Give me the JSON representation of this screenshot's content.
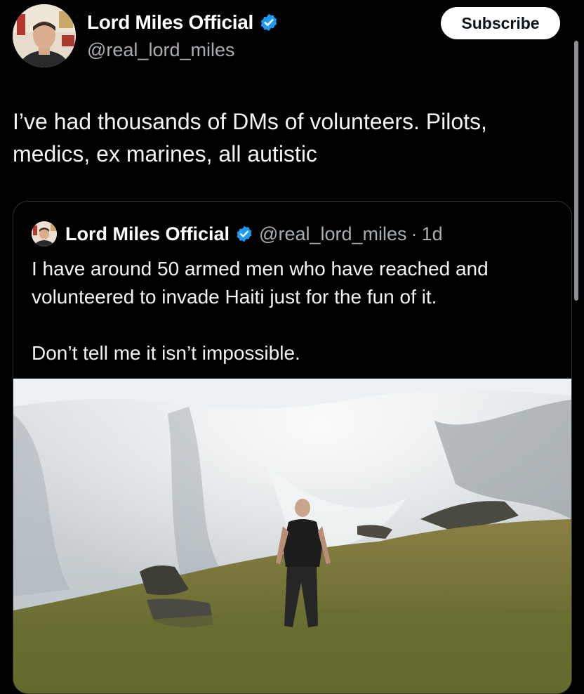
{
  "post": {
    "display_name": "Lord Miles Official",
    "handle": "@real_lord_miles",
    "subscribe_label": "Subscribe",
    "text": "I’ve had thousands of DMs of volunteers. Pilots, medics, ex marines, all autistic"
  },
  "quoted_post": {
    "display_name": "Lord Miles Official",
    "handle": "@real_lord_miles",
    "separator": "·",
    "time": "1d",
    "paragraphs": [
      "I have around 50 armed men who have reached and volunteered to invade Haiti just for the fun of it.",
      "Don’t tell me it isn’t impossible."
    ]
  },
  "colors": {
    "background": "#000000",
    "verified_badge": "#1d9bf0",
    "secondary_text": "#a9aeb3"
  },
  "icons": {
    "verified": "verified-badge-icon"
  }
}
